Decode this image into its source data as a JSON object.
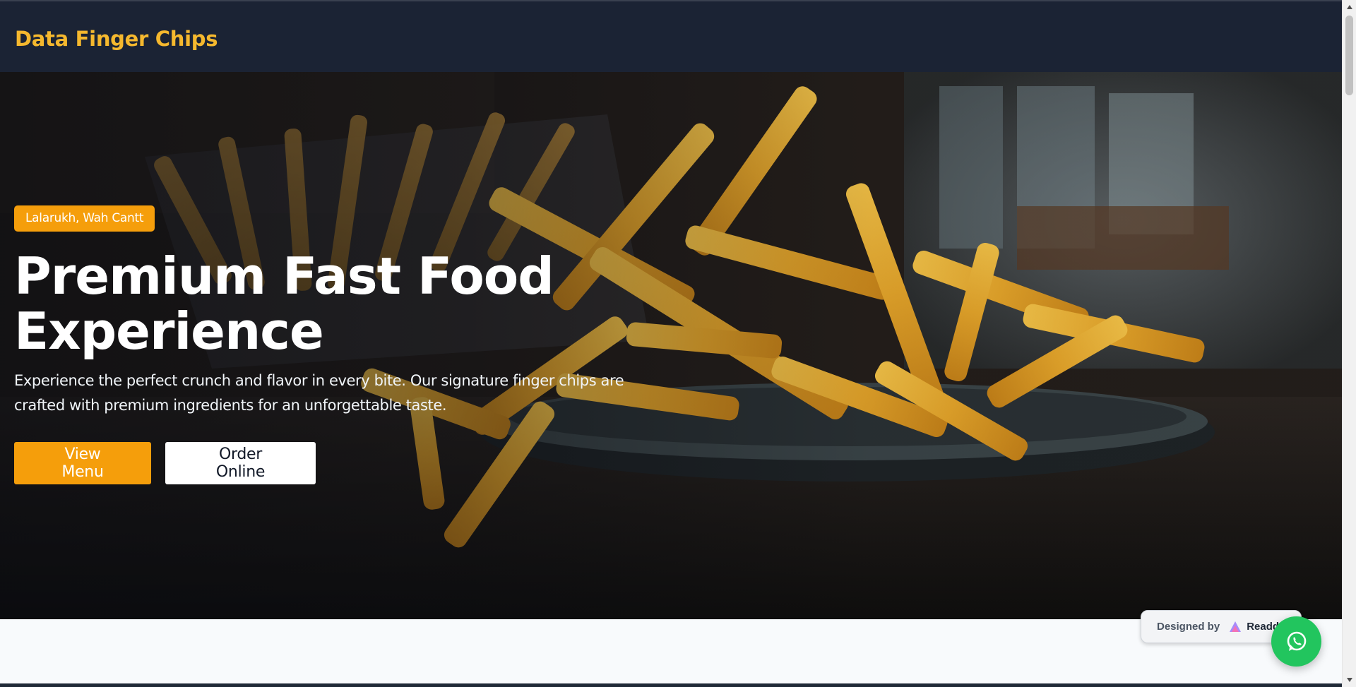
{
  "nav": {
    "brand": "Data Finger Chips"
  },
  "hero": {
    "location_badge": "Lalarukh, Wah Cantt",
    "title_line1": "Premium Fast Food",
    "title_line2": "Experience",
    "description": "Experience the perfect crunch and flavor in every bite. Our signature finger chips are crafted with premium ingredients for an unforgettable taste.",
    "primary_button": "View Menu",
    "secondary_button": "Order Online"
  },
  "designed_by": {
    "label": "Designed by",
    "brand": "Readdy"
  },
  "floating": {
    "whatsapp_icon": "whatsapp-icon"
  },
  "colors": {
    "brand": "#f5b82e",
    "accent": "#f59e0b",
    "nav_bg": "#1b2334",
    "whatsapp": "#22c55e"
  }
}
